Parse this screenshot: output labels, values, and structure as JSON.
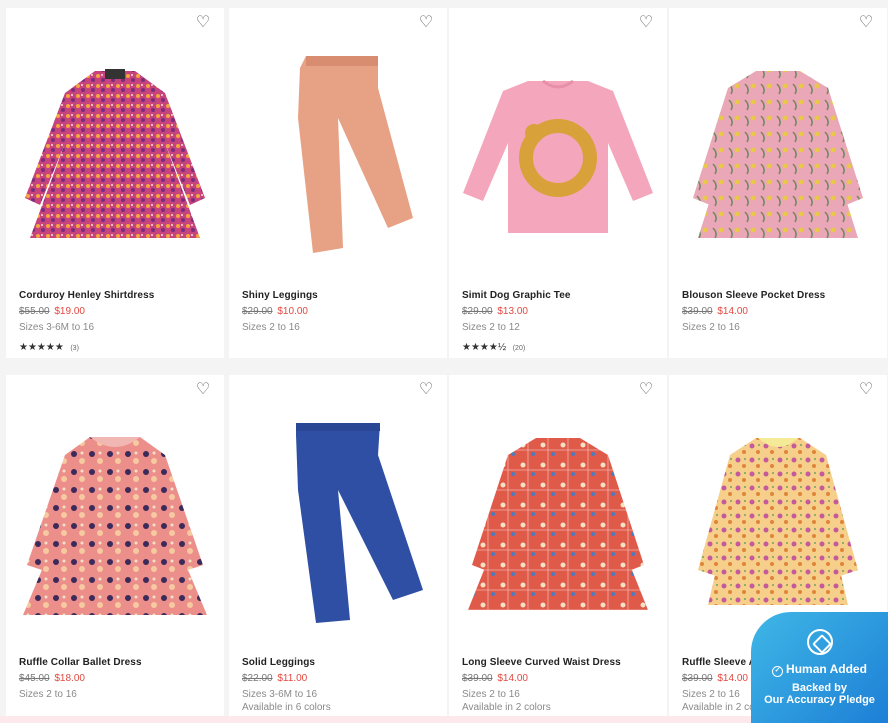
{
  "products": [
    {
      "name": "Corduroy Henley Shirtdress",
      "old_price": "$55.00",
      "new_price": "$19.00",
      "sizes": "Sizes 3-6M to 16",
      "stars": "★★★★★",
      "rating_count": "(3)",
      "colors": "",
      "image": "dress-icon"
    },
    {
      "name": "Shiny Leggings",
      "old_price": "$29.00",
      "new_price": "$10.00",
      "sizes": "Sizes 2 to 16",
      "stars": "",
      "rating_count": "",
      "colors": "",
      "image": "leggings-icon"
    },
    {
      "name": "Simit Dog Graphic Tee",
      "old_price": "$29.00",
      "new_price": "$13.00",
      "sizes": "Sizes 2 to 12",
      "stars": "★★★★½",
      "rating_count": "(20)",
      "colors": "",
      "image": "tee-icon"
    },
    {
      "name": "Blouson Sleeve Pocket Dress",
      "old_price": "$39.00",
      "new_price": "$14.00",
      "sizes": "Sizes 2 to 16",
      "stars": "",
      "rating_count": "",
      "colors": "",
      "image": "dress-icon"
    },
    {
      "name": "Ruffle Collar Ballet Dress",
      "old_price": "$45.00",
      "new_price": "$18.00",
      "sizes": "Sizes 2 to 16",
      "stars": "",
      "rating_count": "",
      "colors": "",
      "image": "dress-icon"
    },
    {
      "name": "Solid Leggings",
      "old_price": "$22.00",
      "new_price": "$11.00",
      "sizes": "Sizes 3-6M to 16",
      "stars": "",
      "rating_count": "",
      "colors": "Available in 6 colors",
      "image": "leggings-icon"
    },
    {
      "name": "Long Sleeve Curved Waist Dress",
      "old_price": "$39.00",
      "new_price": "$14.00",
      "sizes": "Sizes 2 to 16",
      "stars": "",
      "rating_count": "",
      "colors": "Available in 2 colors",
      "image": "dress-icon"
    },
    {
      "name": "Ruffle Sleeve A-Line Dress",
      "old_price": "$39.00",
      "new_price": "$14.00",
      "sizes": "Sizes 2 to 16",
      "stars": "",
      "rating_count": "",
      "colors": "Available in 2 colors",
      "image": "dress-icon"
    }
  ],
  "badge": {
    "title": "Human Added",
    "line1": "Backed by",
    "line2": "Our Accuracy Pledge"
  },
  "colors": {
    "sale_red": "#e3483f",
    "badge_blue": "#1d7fd6"
  }
}
